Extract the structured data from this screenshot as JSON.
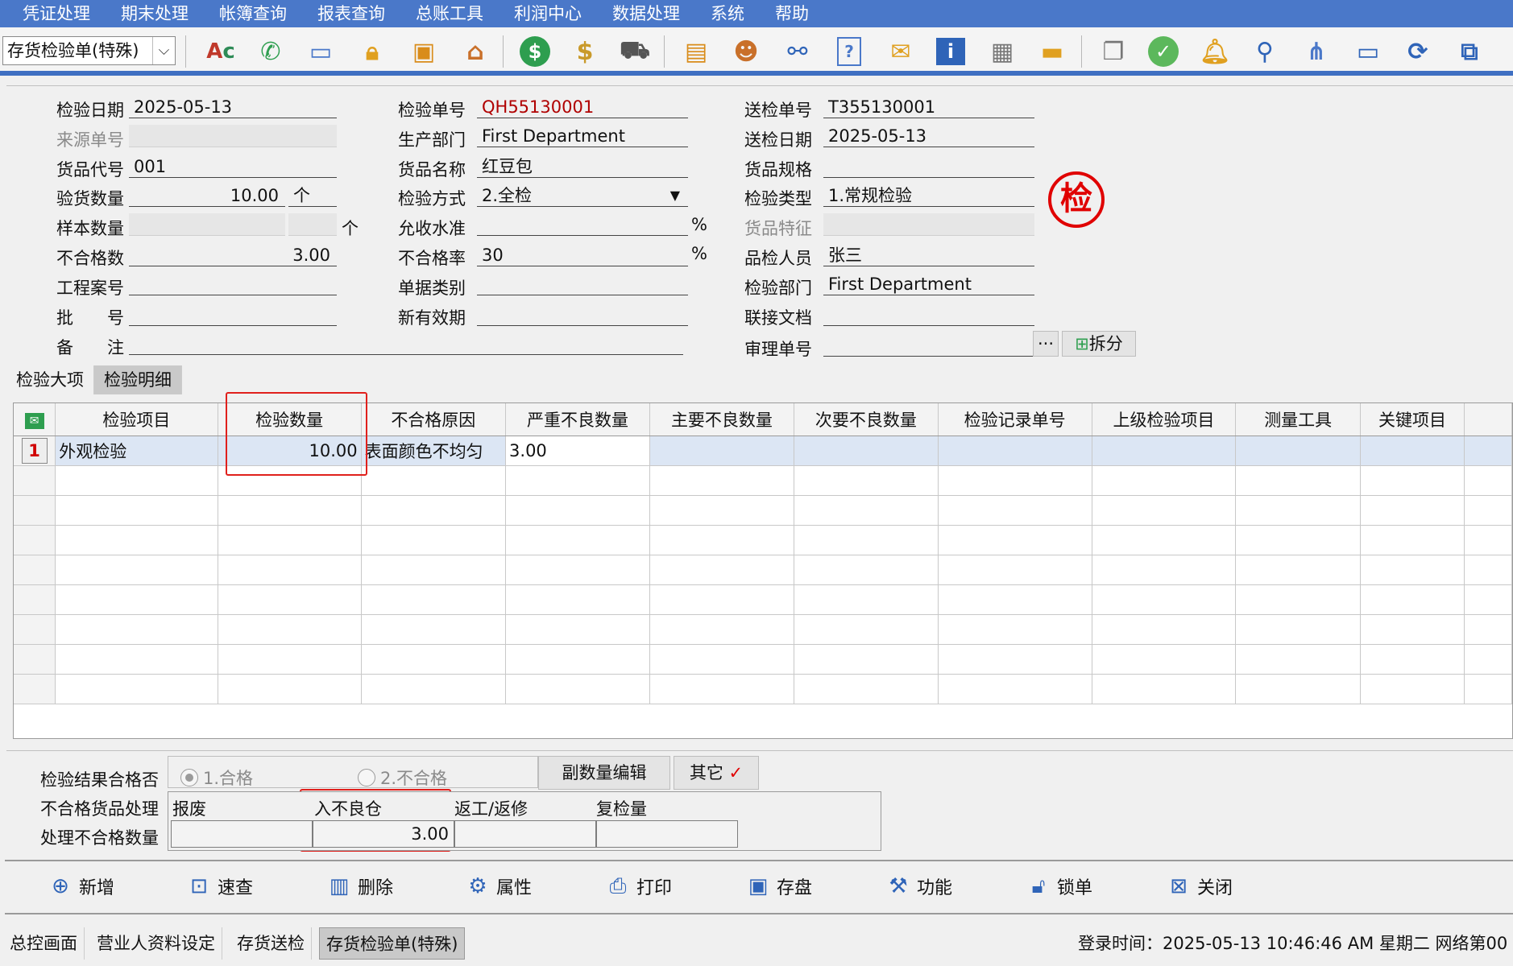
{
  "menu": [
    "凭证处理",
    "期末处理",
    "帐簿查询",
    "报表查询",
    "总账工具",
    "利润中心",
    "数据处理",
    "系统",
    "帮助"
  ],
  "toolbar": {
    "combo_value": "存货检验单(特殊)",
    "icons": [
      "spellcheck-icon",
      "phone-icon",
      "computer-icon",
      "lock-icon",
      "briefcase-icon",
      "home-icon",
      "dollar-icon",
      "money-bag-icon",
      "cart-icon",
      "clipboard-icon",
      "users-icon",
      "link-icon",
      "help-doc-icon",
      "mail-icon",
      "info-icon",
      "calculator-icon",
      "folder-icon",
      "copy-icon",
      "check-icon",
      "bell-icon",
      "search-icon",
      "org-chart-icon",
      "monitor-icon",
      "refresh-icon",
      "window-icon"
    ]
  },
  "form": {
    "check_date_label": "检验日期",
    "check_date": "2025-05-13",
    "source_no_label": "来源单号",
    "source_no": "",
    "item_code_label": "货品代号",
    "item_code": "001",
    "qty_label": "验货数量",
    "qty": "10.00",
    "qty_unit": "个",
    "sample_qty_label": "样本数量",
    "sample_unit": "个",
    "reject_count_label": "不合格数",
    "reject_count": "3.00",
    "project_no_label": "工程案号",
    "batch_label": "批　　号",
    "remark_label": "备　　注",
    "check_no_label": "检验单号",
    "check_no": "QH55130001",
    "prod_dept_label": "生产部门",
    "prod_dept": "First Department",
    "item_name_label": "货品名称",
    "item_name": "红豆包",
    "method_label": "检验方式",
    "method": "2.全检",
    "accept_level_label": "允收水准",
    "accept_unit": "%",
    "reject_rate_label": "不合格率",
    "reject_rate": "30",
    "rate_unit": "%",
    "doc_type_label": "单据类别",
    "valid_label": "新有效期",
    "send_no_label": "送检单号",
    "send_no": "T355130001",
    "send_date_label": "送检日期",
    "send_date": "2025-05-13",
    "spec_label": "货品规格",
    "check_type_label": "检验类型",
    "check_type": "1.常规检验",
    "feature_label": "货品特征",
    "inspector_label": "品检人员",
    "inspector": "张三",
    "check_dept_label": "检验部门",
    "check_dept": "First Department",
    "link_doc_label": "联接文档",
    "review_no_label": "审理单号",
    "ellipsis": "···",
    "split_label": "拆分",
    "stamp_char": "检"
  },
  "tabs": [
    "检验大项",
    "检验明细"
  ],
  "grid": {
    "columns": [
      "检验项目",
      "检验数量",
      "不合格原因",
      "严重不良数量",
      "主要不良数量",
      "次要不良数量",
      "检验记录单号",
      "上级检验项目",
      "测量工具",
      "关键项目"
    ],
    "rows": [
      {
        "no": "1",
        "item": "外观检验",
        "qty": "10.00",
        "reason": "表面颜色不均匀",
        "severe": "3.00"
      }
    ]
  },
  "result": {
    "pass_label": "检验结果合格否",
    "opt_pass": "1.合格",
    "opt_fail": "2.不合格",
    "sub_qty_btn": "副数量编辑",
    "other_btn": "其它",
    "other_check": "✓",
    "handling_label": "不合格货品处理",
    "qty_label": "处理不合格数量",
    "cols": [
      "报废",
      "入不良仓",
      "返工/返修",
      "复检量"
    ],
    "values": [
      "",
      "3.00",
      "",
      ""
    ]
  },
  "actions": [
    "新增",
    "速查",
    "删除",
    "属性",
    "打印",
    "存盘",
    "功能",
    "锁单",
    "关闭"
  ],
  "taskbar": {
    "tabs": [
      "总控画面",
      "营业人资料设定",
      "存货送检",
      "存货检验单(特殊)"
    ],
    "status": "登录时间：2025-05-13 10:46:46 AM  星期二    网络第00"
  }
}
